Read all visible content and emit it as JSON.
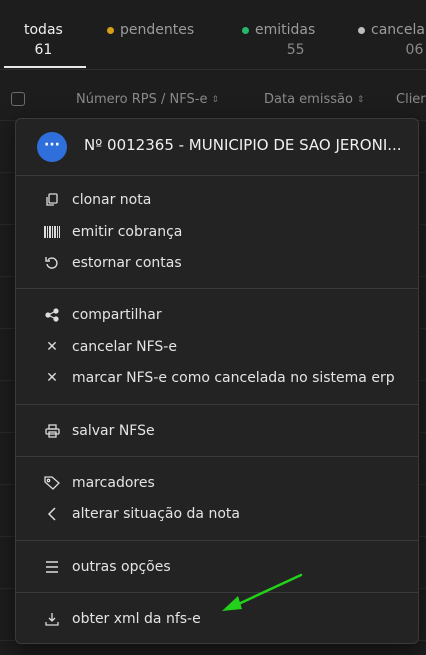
{
  "tabs": [
    {
      "label": "todas",
      "count": "61",
      "dot_color": ""
    },
    {
      "label": "pendentes",
      "count": "",
      "dot_color": "#d4a017"
    },
    {
      "label": "emitidas",
      "count": "55",
      "dot_color": "#25b86b"
    },
    {
      "label": "cancela",
      "count": "06",
      "dot_color": "#bdbdbd"
    }
  ],
  "table": {
    "col_rps": "Número RPS / NFS-e",
    "col_date": "Data emissão",
    "col_client": "Clier"
  },
  "menu": {
    "title": "Nº 0012365 - MUNICIPIO DE SAO JERONI...",
    "more_symbol": "···",
    "items": [
      {
        "label": "clonar nota",
        "icon": "copy-icon"
      },
      {
        "label": "emitir cobrança",
        "icon": "barcode-icon"
      },
      {
        "label": "estornar contas",
        "icon": "undo-icon"
      },
      {
        "label": "compartilhar",
        "icon": "share-icon"
      },
      {
        "label": "cancelar NFS-e",
        "icon": "x-icon"
      },
      {
        "label": "marcar NFS-e como cancelada no sistema erp",
        "icon": "x-icon"
      },
      {
        "label": "salvar NFSe",
        "icon": "printer-icon"
      },
      {
        "label": "marcadores",
        "icon": "tag-icon"
      },
      {
        "label": "alterar situação da nota",
        "icon": "chevron-left-icon"
      },
      {
        "label": "outras opções",
        "icon": "menu-lines-icon"
      },
      {
        "label": "obter xml da nfs-e",
        "icon": "download-icon"
      }
    ]
  },
  "colors": {
    "accent": "#2f6fdc",
    "arrow": "#22d11a"
  }
}
